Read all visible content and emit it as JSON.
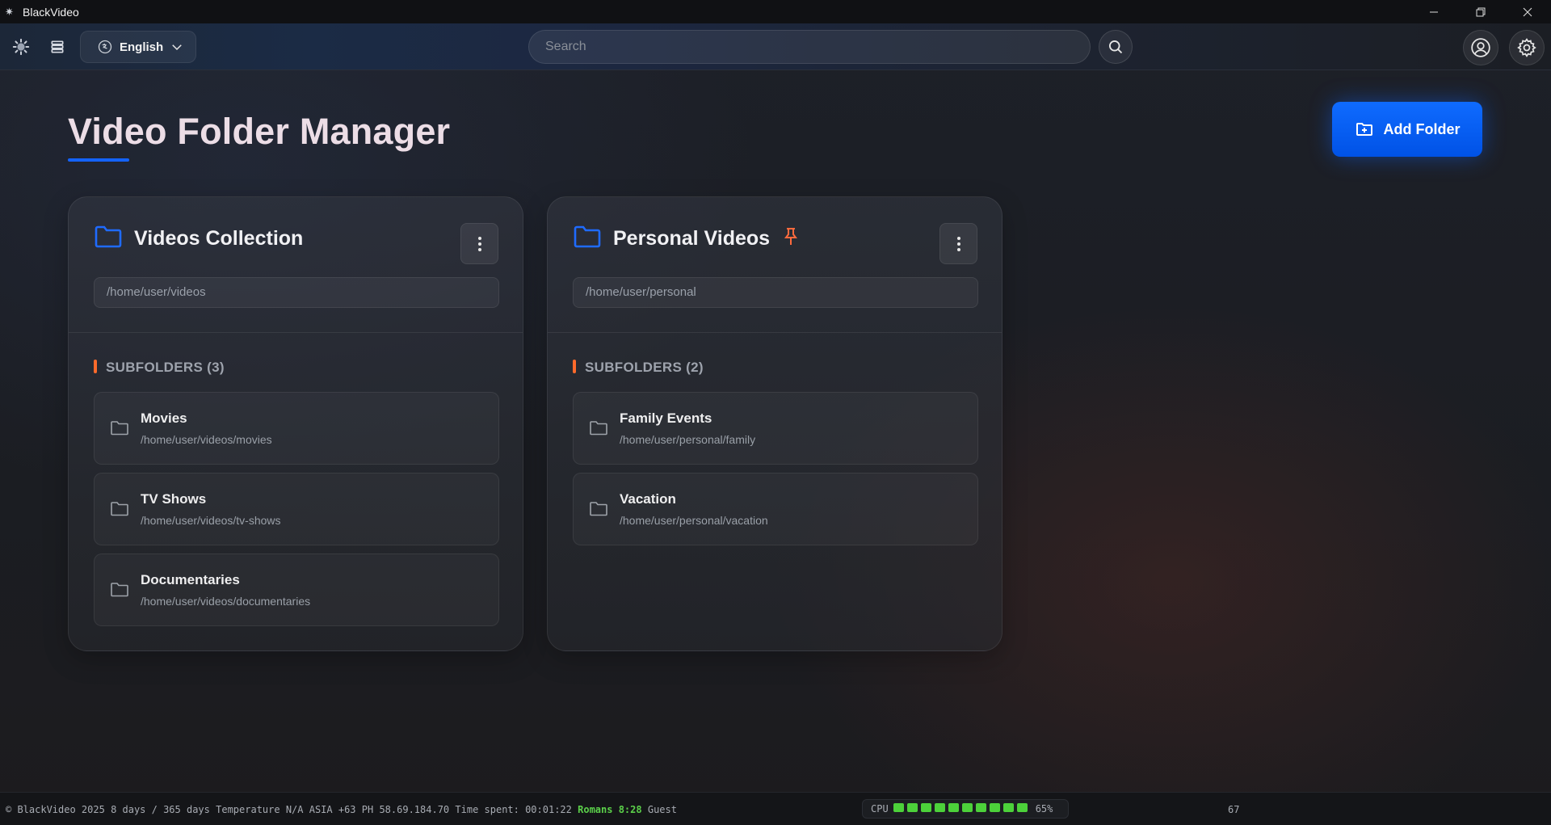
{
  "window": {
    "title": "BlackVideo"
  },
  "toolbar": {
    "language": "English",
    "search_placeholder": "Search"
  },
  "page": {
    "title": "Video Folder Manager",
    "add_folder_label": "Add Folder",
    "accent_color": "#1463ff",
    "marker_color": "#ff6a2b"
  },
  "folders": [
    {
      "title": "Videos Collection",
      "pinned": false,
      "path": "/home/user/videos",
      "subfolders_heading": "SUBFOLDERS (3)",
      "subfolders": [
        {
          "name": "Movies",
          "path": "/home/user/videos/movies"
        },
        {
          "name": "TV Shows",
          "path": "/home/user/videos/tv-shows"
        },
        {
          "name": "Documentaries",
          "path": "/home/user/videos/documentaries"
        }
      ]
    },
    {
      "title": "Personal Videos",
      "pinned": true,
      "path": "/home/user/personal",
      "subfolders_heading": "SUBFOLDERS (2)",
      "subfolders": [
        {
          "name": "Family Events",
          "path": "/home/user/personal/family"
        },
        {
          "name": "Vacation",
          "path": "/home/user/personal/vacation"
        }
      ]
    }
  ],
  "status": {
    "copyright": "© BlackVideo 2025",
    "days": "8 days / 365 days",
    "temperature": "Temperature N/A",
    "region": "ASIA +63 PH",
    "ip": "58.69.184.70",
    "time_spent": "Time spent: 00:01:22",
    "user_time": "Romans 8:28",
    "user": "Guest",
    "cpu_label": "CPU",
    "cpu_percent": "65%",
    "cpu_segments_on": 10,
    "cpu_segments_total": 10,
    "count": "67"
  }
}
